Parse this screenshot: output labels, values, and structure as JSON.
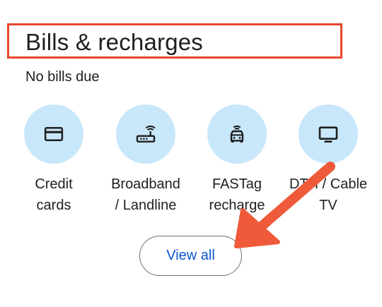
{
  "section": {
    "title": "Bills & recharges",
    "status": "No bills due"
  },
  "tiles": [
    {
      "label": "Credit\ncards",
      "icon": "credit-card-icon"
    },
    {
      "label": "Broadband\n/ Landline",
      "icon": "router-icon"
    },
    {
      "label": "FASTag\nrecharge",
      "icon": "car-icon"
    },
    {
      "label": "DTH / Cable\nTV",
      "icon": "tv-icon"
    }
  ],
  "view_all": {
    "label": "View all"
  },
  "colors": {
    "highlight": "#e8472d",
    "icon_bg": "#c9e7fb",
    "link": "#0b57d0"
  }
}
